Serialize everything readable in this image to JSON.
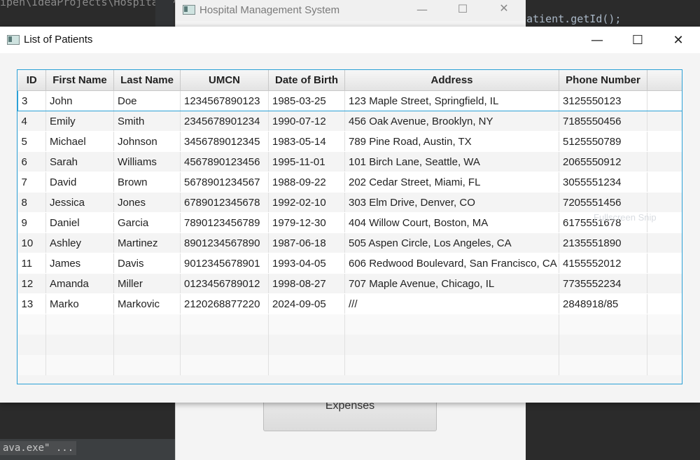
{
  "ide": {
    "path_text": "ipen\\IdeaProjects\\Hospital M",
    "code_text": "atient.getId();",
    "run_text": "ava.exe\" ..."
  },
  "main_window": {
    "title": "Hospital Management System",
    "expenses_label": "Expenses"
  },
  "overlay": {
    "snip_text": "Fullscreen Snip"
  },
  "patients_window": {
    "title": "List of Patients",
    "columns": [
      "ID",
      "First Name",
      "Last Name",
      "UMCN",
      "Date of Birth",
      "Address",
      "Phone Number"
    ],
    "rows": [
      [
        "3",
        "John",
        "Doe",
        "1234567890123",
        "1985-03-25",
        "123 Maple Street, Springfield, IL",
        "3125550123"
      ],
      [
        "4",
        "Emily",
        "Smith",
        "2345678901234",
        "1990-07-12",
        "456 Oak Avenue, Brooklyn, NY",
        "7185550456"
      ],
      [
        "5",
        "Michael",
        "Johnson",
        "3456789012345",
        "1983-05-14",
        "789 Pine Road, Austin, TX",
        "5125550789"
      ],
      [
        "6",
        "Sarah",
        "Williams",
        "4567890123456",
        "1995-11-01",
        "101 Birch Lane, Seattle, WA",
        "2065550912"
      ],
      [
        "7",
        "David",
        "Brown",
        "5678901234567",
        "1988-09-22",
        "202 Cedar Street, Miami, FL",
        "3055551234"
      ],
      [
        "8",
        "Jessica",
        "Jones",
        "6789012345678",
        "1992-02-10",
        "303 Elm Drive, Denver, CO",
        "7205551456"
      ],
      [
        "9",
        "Daniel",
        "Garcia",
        "7890123456789",
        "1979-12-30",
        "404 Willow Court, Boston, MA",
        "6175551678"
      ],
      [
        "10",
        "Ashley",
        "Martinez",
        "8901234567890",
        "1987-06-18",
        "505 Aspen Circle, Los Angeles, CA",
        "2135551890"
      ],
      [
        "11",
        "James",
        "Davis",
        "9012345678901",
        "1993-04-05",
        "606 Redwood Boulevard, San Francisco, CA",
        "4155552012"
      ],
      [
        "12",
        "Amanda",
        "Miller",
        "0123456789012",
        "1998-08-27",
        "707 Maple Avenue, Chicago, IL",
        "7735552234"
      ],
      [
        "13",
        "Marko",
        "Markovic",
        "2120268877220",
        "2024-09-05",
        "///",
        "2848918/85"
      ]
    ],
    "selected_row": 0,
    "empty_rows": 3,
    "accent_color": "#2aa0d6"
  }
}
